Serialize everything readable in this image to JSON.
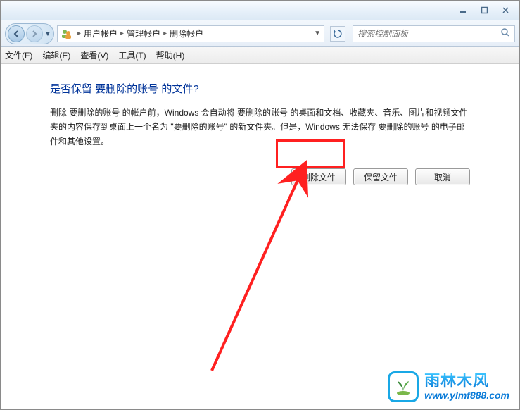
{
  "titlebar": {
    "minimize_icon": "minimize-icon",
    "maximize_icon": "maximize-icon",
    "close_icon": "close-icon"
  },
  "breadcrumb": {
    "items": [
      "用户帐户",
      "管理帐户",
      "删除帐户"
    ],
    "separator": "▸"
  },
  "search": {
    "placeholder": "搜索控制面板"
  },
  "menubar": {
    "file": "文件(F)",
    "edit": "编辑(E)",
    "view": "查看(V)",
    "tools": "工具(T)",
    "help": "帮助(H)"
  },
  "content": {
    "heading": "是否保留 要删除的账号 的文件?",
    "body": "删除 要删除的账号 的帐户前，Windows 会自动将 要删除的账号 的桌面和文档、收藏夹、音乐、图片和视频文件夹的内容保存到桌面上一个名为 \"要删除的账号\" 的新文件夹。但是，Windows 无法保存 要删除的账号 的电子邮件和其他设置。"
  },
  "buttons": {
    "delete_files": "删除文件",
    "keep_files": "保留文件",
    "cancel": "取消"
  },
  "watermark": {
    "cn": "雨林木风",
    "url": "www.ylmf888.com"
  },
  "annotation": {
    "highlight_target": "delete-files-button"
  }
}
